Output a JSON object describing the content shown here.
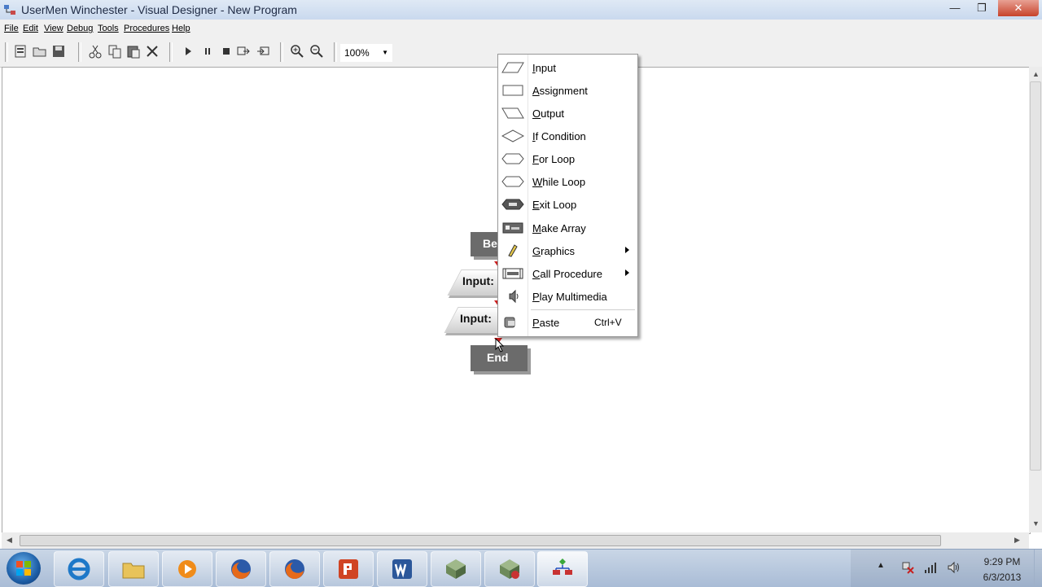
{
  "window": {
    "title": "UserMen Winchester - Visual Designer - New Program"
  },
  "menubar": {
    "items": [
      "File",
      "Edit",
      "View",
      "Debug",
      "Tools",
      "Procedures",
      "Help"
    ]
  },
  "toolbar": {
    "zoom": "100%"
  },
  "flowchart": {
    "begin": "Begin",
    "input1": "Input:",
    "input2": "Input:",
    "end": "End"
  },
  "context_menu": {
    "items": [
      {
        "label": "Input",
        "icon": "input-shape-icon"
      },
      {
        "label": "Assignment",
        "icon": "assignment-shape-icon"
      },
      {
        "label": "Output",
        "icon": "output-shape-icon"
      },
      {
        "label": "If Condition",
        "icon": "diamond-icon"
      },
      {
        "label": "For Loop",
        "icon": "hexagon-icon"
      },
      {
        "label": "While Loop",
        "icon": "hexagon-icon"
      },
      {
        "label": "Exit Loop",
        "icon": "exit-icon"
      },
      {
        "label": "Make Array",
        "icon": "array-icon"
      },
      {
        "label": "Graphics",
        "icon": "pencil-icon"
      },
      {
        "label": "Call Procedure",
        "icon": "proc-icon"
      },
      {
        "label": "Play Multimedia",
        "icon": "speaker-icon"
      }
    ],
    "paste": {
      "label": "Paste",
      "shortcut": "Ctrl+V"
    }
  },
  "taskbar": {
    "time": "9:29 PM",
    "date": "6/3/2013"
  }
}
